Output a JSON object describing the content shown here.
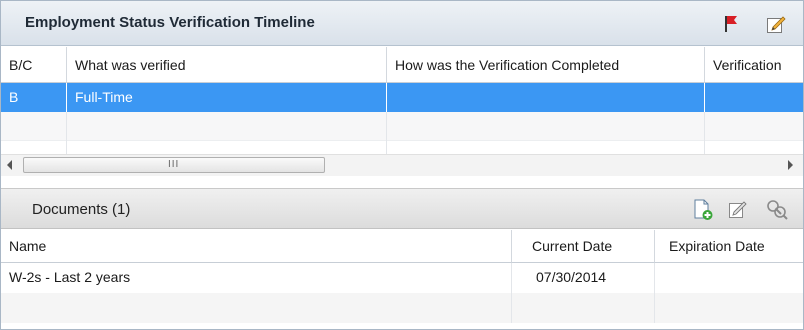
{
  "panel": {
    "title": "Employment Status Verification Timeline"
  },
  "timeline": {
    "columns": [
      "B/C",
      "What was verified",
      "How was the Verification Completed",
      "Verification"
    ],
    "rows": [
      {
        "bc": "B",
        "what": "Full-Time",
        "how": "",
        "verification": ""
      }
    ]
  },
  "scrollbar": {
    "grip": "III"
  },
  "documents": {
    "title": "Documents (1)",
    "columns": [
      "Name",
      "Current Date",
      "Expiration Date"
    ],
    "rows": [
      {
        "name": "W-2s - Last 2 years",
        "current_date": "07/30/2014",
        "expiration_date": ""
      }
    ]
  },
  "colors": {
    "selection": "#3b97f3",
    "flag": "#d81f26",
    "header_gradient_top": "#eef2f6",
    "header_gradient_bottom": "#d9e1ea"
  },
  "icons": {
    "flag": "flag-icon",
    "edit": "edit-icon",
    "add_document": "add-document-icon",
    "edit_document": "edit-document-icon",
    "view_document": "view-document-icon"
  }
}
